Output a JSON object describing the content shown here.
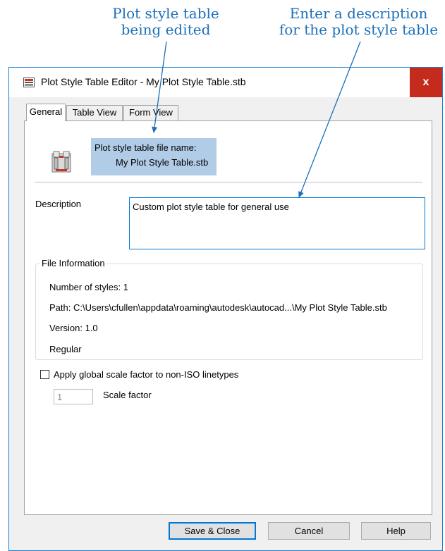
{
  "callouts": {
    "left": [
      "Plot style table",
      "being edited"
    ],
    "right": [
      "Enter a description",
      "for the plot style table"
    ],
    "color": "#1b6fb8"
  },
  "window": {
    "title": "Plot Style Table Editor - My Plot Style Table.stb",
    "close_label": "x",
    "accent": "#1b7fd1"
  },
  "tabs": [
    {
      "label": "General",
      "active": true
    },
    {
      "label": "Table View",
      "active": false
    },
    {
      "label": "Form View",
      "active": false
    }
  ],
  "general": {
    "file_name_label": "Plot style table file name:",
    "file_name_value": "My Plot Style Table.stb",
    "description_label": "Description",
    "description_value": "Custom plot style table for general use",
    "file_info": {
      "title": "File Information",
      "lines": [
        "Number of styles: 1",
        "Path: C:\\Users\\cfullen\\appdata\\roaming\\autodesk\\autocad...\\My Plot Style Table.stb",
        "Version: 1.0",
        "Regular"
      ]
    },
    "apply_scale_label": "Apply global scale factor to non-ISO linetypes",
    "apply_scale_checked": false,
    "scale_factor_value": "1",
    "scale_factor_label": "Scale factor"
  },
  "buttons": {
    "save": "Save & Close",
    "cancel": "Cancel",
    "help": "Help"
  }
}
